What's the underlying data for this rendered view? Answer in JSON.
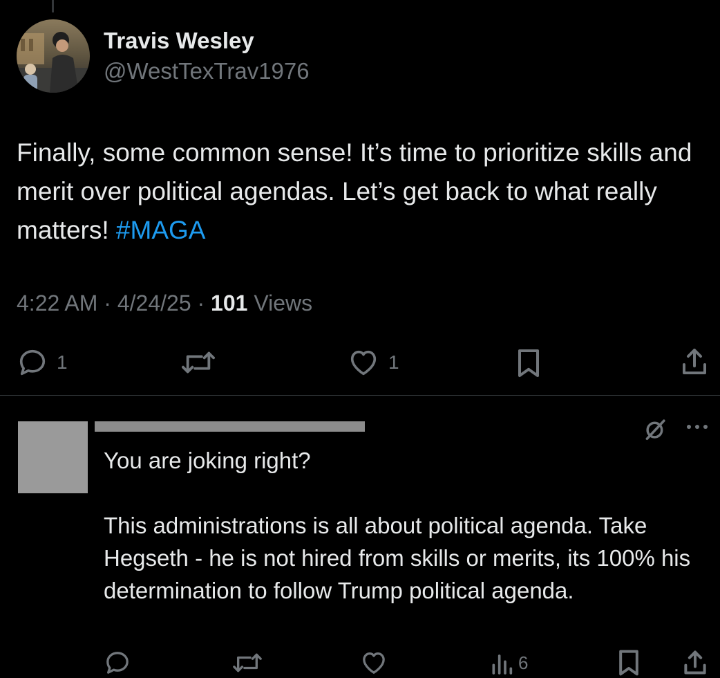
{
  "post": {
    "author": {
      "display_name": "Travis Wesley",
      "handle": "@WestTexTrav1976"
    },
    "text_main": "Finally, some common sense! It’s time to prioritize skills and merit over political agendas. Let’s get back to what really matters! ",
    "hashtag": "#MAGA",
    "time": "4:22 AM",
    "sep1": " · ",
    "date": "4/24/25",
    "sep2": " · ",
    "views_count": "101",
    "views_label": " Views",
    "actions": {
      "reply_count": "1",
      "like_count": "1"
    }
  },
  "reply": {
    "line1": "You are joking right?",
    "line2": "This administrations is all about political agenda. Take Hegseth - he is not hired from skills or merits, its 100% his determination to follow Trump political agenda.",
    "actions": {
      "views_count": "6"
    }
  },
  "colors": {
    "background": "#000000",
    "text": "#e7e9ea",
    "secondary": "#71767b",
    "accent": "#1d9bf0",
    "divider": "#2f3336"
  },
  "icons": {
    "reply": "speech-bubble-icon",
    "repost": "repost-arrows-icon",
    "like": "heart-icon",
    "bookmark": "bookmark-icon",
    "share": "share-upload-icon",
    "views": "bar-chart-icon",
    "grok": "grok-slash-circle-icon",
    "more": "ellipsis-icon"
  }
}
